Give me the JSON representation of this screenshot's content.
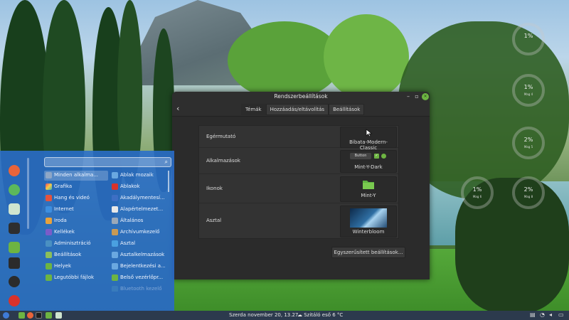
{
  "window": {
    "title": "Rendszerbeállítások",
    "back_glyph": "‹",
    "controls": {
      "minimize": "–",
      "maximize": "▫",
      "close": "×"
    },
    "tabs": [
      {
        "label": "Témák",
        "active": true
      },
      {
        "label": "Hozzáadás/eltávolítás",
        "active": false
      },
      {
        "label": "Beállítások",
        "active": false
      }
    ],
    "rows": [
      {
        "label": "Egérmutató",
        "value": "Bibata-Modern-Classic"
      },
      {
        "label": "Alkalmazások",
        "value": "Mint-Y-Dark",
        "preview_button": "Button"
      },
      {
        "label": "Ikonok",
        "value": "Mint-Y"
      },
      {
        "label": "Asztal",
        "value": "Winterbloom"
      }
    ],
    "simplified_button": "Egyszerűsített beállítások..."
  },
  "menu": {
    "search_placeholder": "",
    "categories": [
      "Minden alkalma...",
      "Grafika",
      "Hang és videó",
      "Internet",
      "Iroda",
      "Kellékek",
      "Adminisztráció",
      "Beállítások",
      "Helyek",
      "Legutóbbi fájlok"
    ],
    "apps": [
      "Ablak mozaik",
      "Ablakok",
      "Akadálymentesí...",
      "Alapértelmezet...",
      "Általános",
      "Archívumkezelő",
      "Asztal",
      "Asztalkelmazások",
      "Bejelentkezési a...",
      "Belső vezérlőpr...",
      "Bluetooth kezelő"
    ]
  },
  "desklets": [
    {
      "value": "1%",
      "sub": "Mag 5"
    },
    {
      "value": "1%",
      "sub": "Mag 4"
    },
    {
      "value": "2%",
      "sub": "Mag 5"
    },
    {
      "value": "1%",
      "sub": "Mag 6"
    },
    {
      "value": "2%",
      "sub": "Mag 8"
    }
  ],
  "panel": {
    "clock": "Szerda november 20, 13.27",
    "weather": "Szitáló eső 6 °C"
  },
  "colors": {
    "menu_bg": "#2a6ecd",
    "accent_green": "#6db442",
    "window_bg": "#2b2b2b"
  }
}
